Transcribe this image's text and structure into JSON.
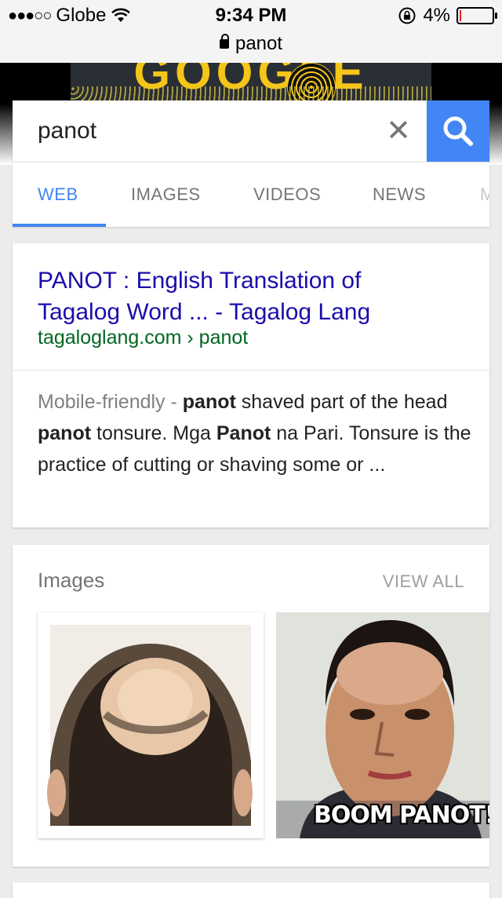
{
  "status_bar": {
    "signal": "●●●○○",
    "carrier": "Globe",
    "time": "9:34 PM",
    "battery_percent": "4%",
    "battery_level": 0.04
  },
  "browser": {
    "url": "panot"
  },
  "doodle": {
    "text": "GOOGLE"
  },
  "search": {
    "query": "panot"
  },
  "tabs": [
    {
      "label": "WEB",
      "active": true
    },
    {
      "label": "IMAGES"
    },
    {
      "label": "VIDEOS"
    },
    {
      "label": "NEWS"
    },
    {
      "label": "M"
    }
  ],
  "result": {
    "title_line1": "PANOT : English Translation of",
    "title_line2": "Tagalog Word ... - Tagalog Lang",
    "url": "tagaloglang.com › panot",
    "snippet": {
      "prefix": "Mobile-friendly - ",
      "b1": "panot",
      "t1": " shaved part of the head ",
      "b2": "panot",
      "t2": " tonsure. Mga ",
      "b3": "Panot",
      "t3": " na Pari. Tonsure is the practice of cutting or shaving some or ..."
    }
  },
  "images": {
    "header": "Images",
    "view_all": "VIEW ALL",
    "thumb2_caption": "BOOM PANOT!"
  },
  "colors": {
    "accent": "#4285f4",
    "link": "#1a0dab",
    "url_green": "#006621"
  }
}
